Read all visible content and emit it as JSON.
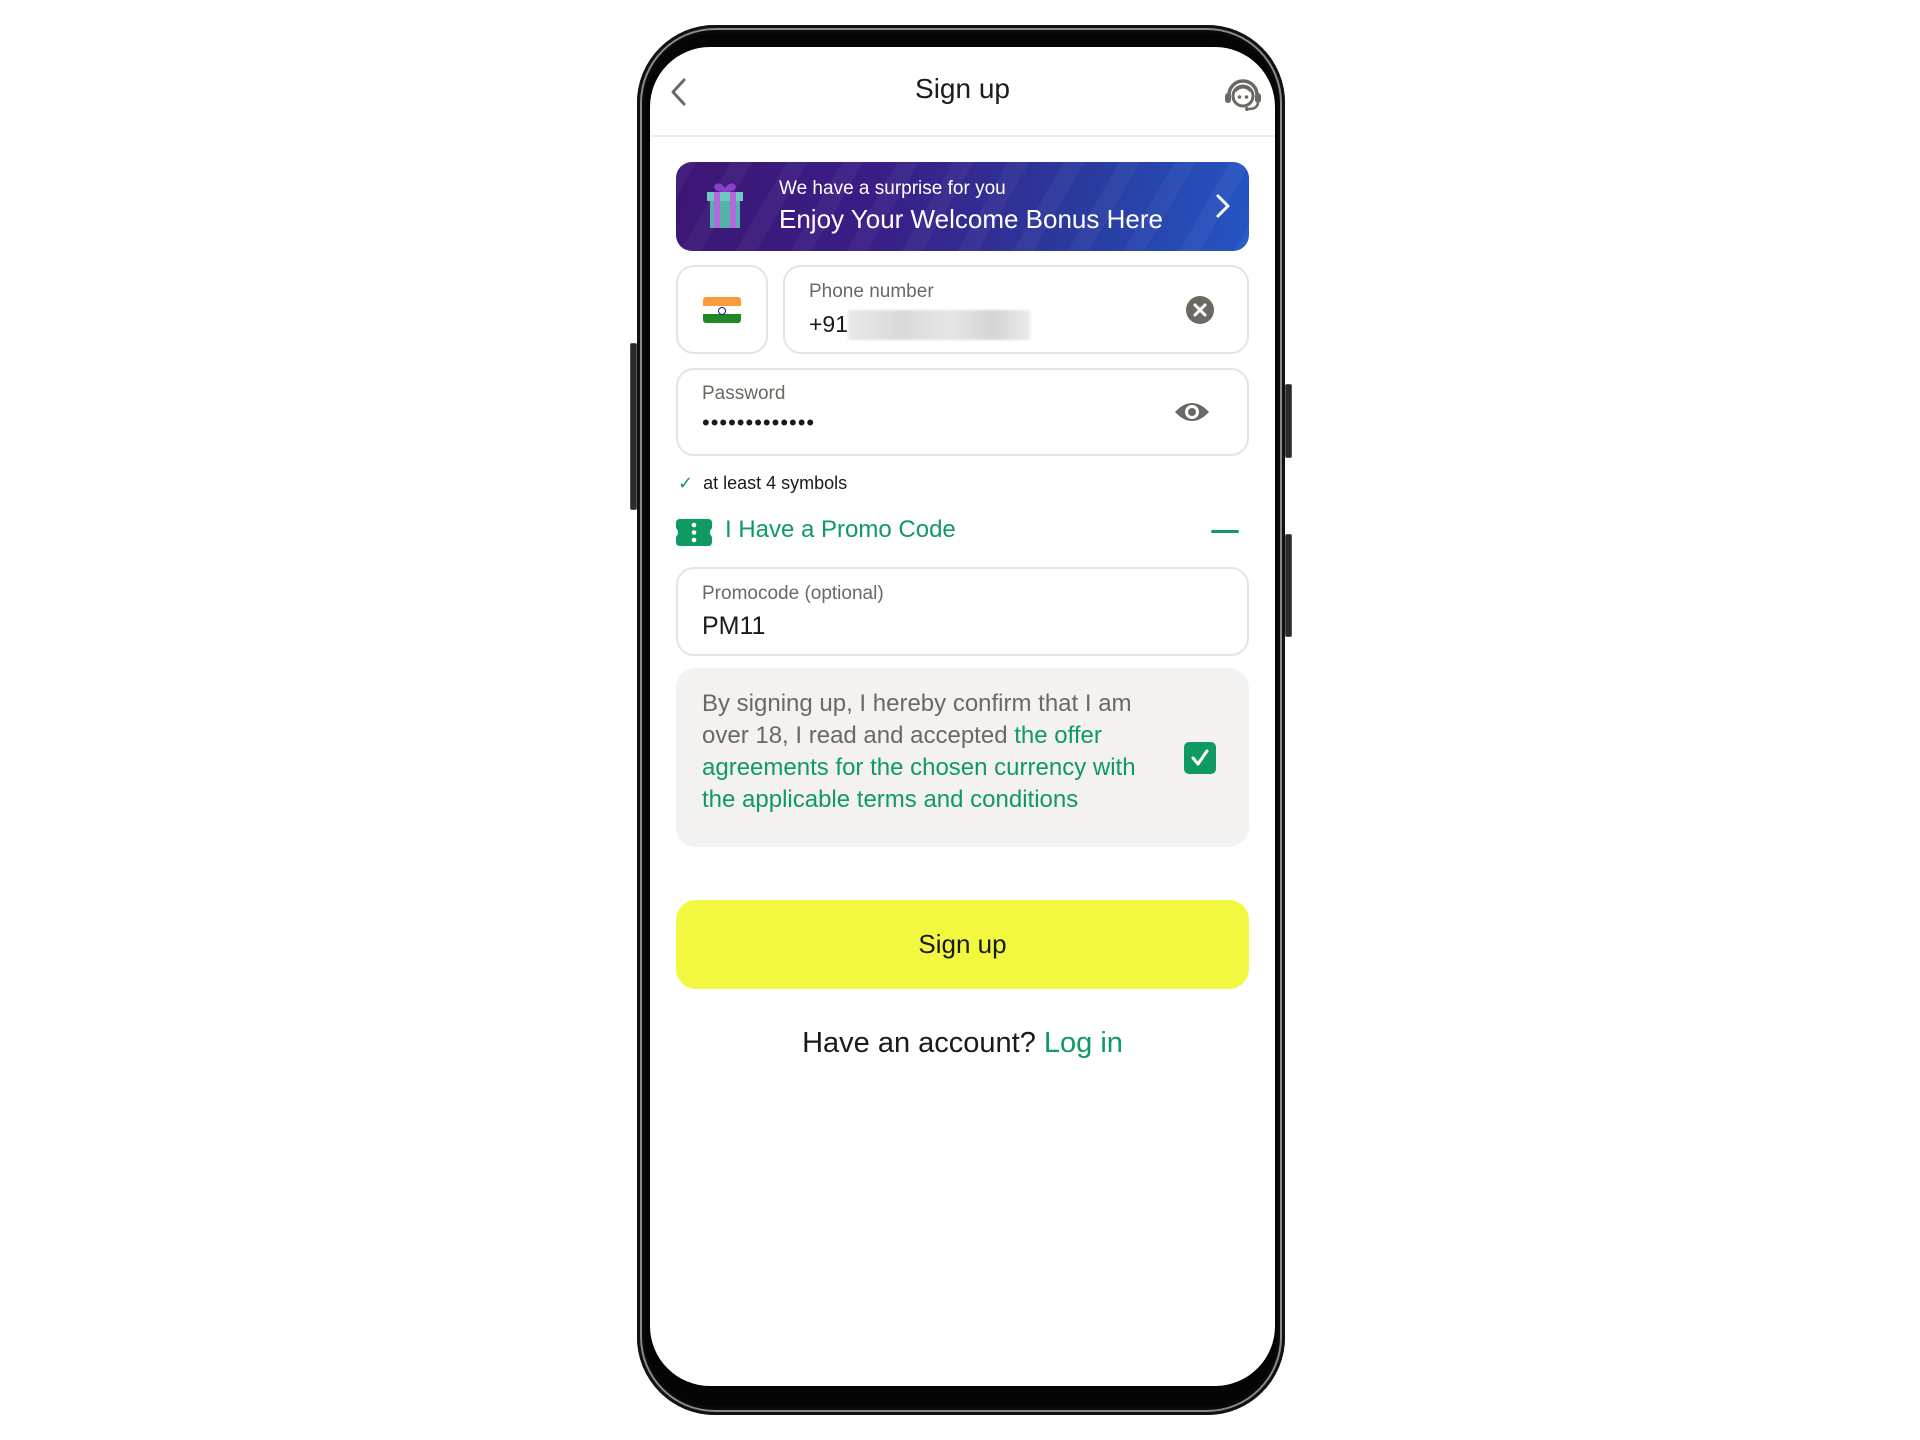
{
  "header": {
    "title": "Sign up",
    "back_icon": "chevron-left-icon",
    "support_icon": "headset-support-icon"
  },
  "banner": {
    "subtitle": "We have a surprise for you",
    "title": "Enjoy Your Welcome Bonus Here",
    "icon": "gift-icon",
    "arrow_icon": "chevron-right-icon",
    "colors": {
      "from": "#3c1675",
      "to": "#2456c4"
    }
  },
  "country": {
    "flag": "india-flag",
    "label": "India"
  },
  "phone": {
    "label": "Phone number",
    "prefix": "+91",
    "value_redacted": true,
    "clear_icon": "clear-circle-icon"
  },
  "password": {
    "label": "Password",
    "value_masked": "•••••••••••••",
    "toggle_icon": "eye-icon"
  },
  "password_hint": {
    "icon": "check-icon",
    "text": "at least 4 symbols"
  },
  "promo": {
    "toggle_label": "I Have a Promo Code",
    "toggle_icon": "ticket-icon",
    "collapse_icon": "minus-icon",
    "field_label": "Promocode (optional)",
    "field_value": "PM11"
  },
  "terms": {
    "text_plain": "By signing up, I hereby confirm that I am over 18, I read and accepted ",
    "text_link": "the offer agreements for the chosen currency with the applicable terms and conditions",
    "checked": true
  },
  "actions": {
    "signup_label": "Sign up",
    "have_account": "Have an account?",
    "login_label": "Log in"
  },
  "colors": {
    "accent_green": "#0f9a63",
    "button_yellow": "#f2f73f",
    "muted_text": "#6c6862"
  }
}
